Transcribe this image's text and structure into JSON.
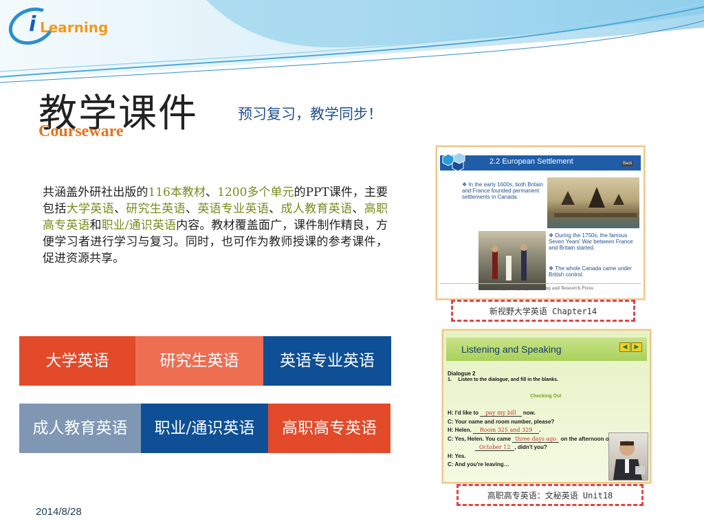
{
  "logo": {
    "prefix": "i",
    "word": "Learning"
  },
  "title": {
    "cn": "教学课件",
    "en": "Courseware"
  },
  "slogan": "预习复习，教学同步！",
  "description": {
    "p1": "共涵盖外研社出版的",
    "h1": "116本教材",
    "p2": "、",
    "h2": "1200多个单元",
    "p3": "的PPT课件，主要包括",
    "h3": "大学英语",
    "p4": "、",
    "h4": "研究生英语",
    "p5": "、",
    "h5": "英语专业英语",
    "p6": "、",
    "h6": "成人教育英语",
    "p7": "、",
    "h7": "高职高专英语",
    "p8": "和",
    "h8": "职业/通识英语",
    "p9": "内容。教材覆盖面广，课件制作精良，方便学习者进行学习与复习。同时，也可作为教师授课的参考课件，促进资源共享。"
  },
  "tiles": [
    {
      "label": "大学英语",
      "color": "#e24a2a"
    },
    {
      "label": "研究生英语",
      "color": "#ee6e52"
    },
    {
      "label": "英语专业英语",
      "color": "#0e4f96"
    },
    {
      "label": "成人教育英语",
      "color": "#7f97b3"
    },
    {
      "label": "职业/通识英语",
      "color": "#0e4f96"
    },
    {
      "label": "高职高专英语",
      "color": "#e24a2a"
    }
  ],
  "shot1": {
    "header": "2.2 European Settlement",
    "back": "Back",
    "bullet1": "In the early 1600s, both Britain and France founded permanent settlements in Canada.",
    "bullet2": "During the 1750s, the famous Seven Years' War between France and Britain started.",
    "bullet3": "The whole Canada came under British control.",
    "footer": "Foreign Language Teaching and Research Press",
    "caption": "新视野大学英语 Chapter14"
  },
  "shot2": {
    "header": "Listening and Speaking",
    "dialogue": "Dialogue 2",
    "instruction": "1.     Listen to the dialogue, and fill in the blanks.",
    "section": "Checking Out",
    "lines": [
      {
        "pre": "H: I'd like to ",
        "fill": "pay my bill",
        "post": " now."
      },
      {
        "pre": "C: Your name and room number, please?",
        "fill": "",
        "post": ""
      },
      {
        "pre": "H: Helen. ",
        "fill": "Room 325 and 329",
        "post": "."
      },
      {
        "pre": "C: Yes, Helen. You came ",
        "fill": "three days ago",
        "post": " on the afternoon of"
      },
      {
        "pre": "",
        "fill": "October 12",
        "post": ", didn't you?"
      },
      {
        "pre": "H: Yes.",
        "fill": "",
        "post": ""
      },
      {
        "pre": "C: And you're leaving…",
        "fill": "",
        "post": ""
      }
    ],
    "caption": "高职高专英语：文秘英语 Unit18"
  },
  "date": "2014/8/28",
  "colors": {
    "wave": "#5ab4e0",
    "accent": "#e8731c",
    "navy": "#0e4f96"
  }
}
